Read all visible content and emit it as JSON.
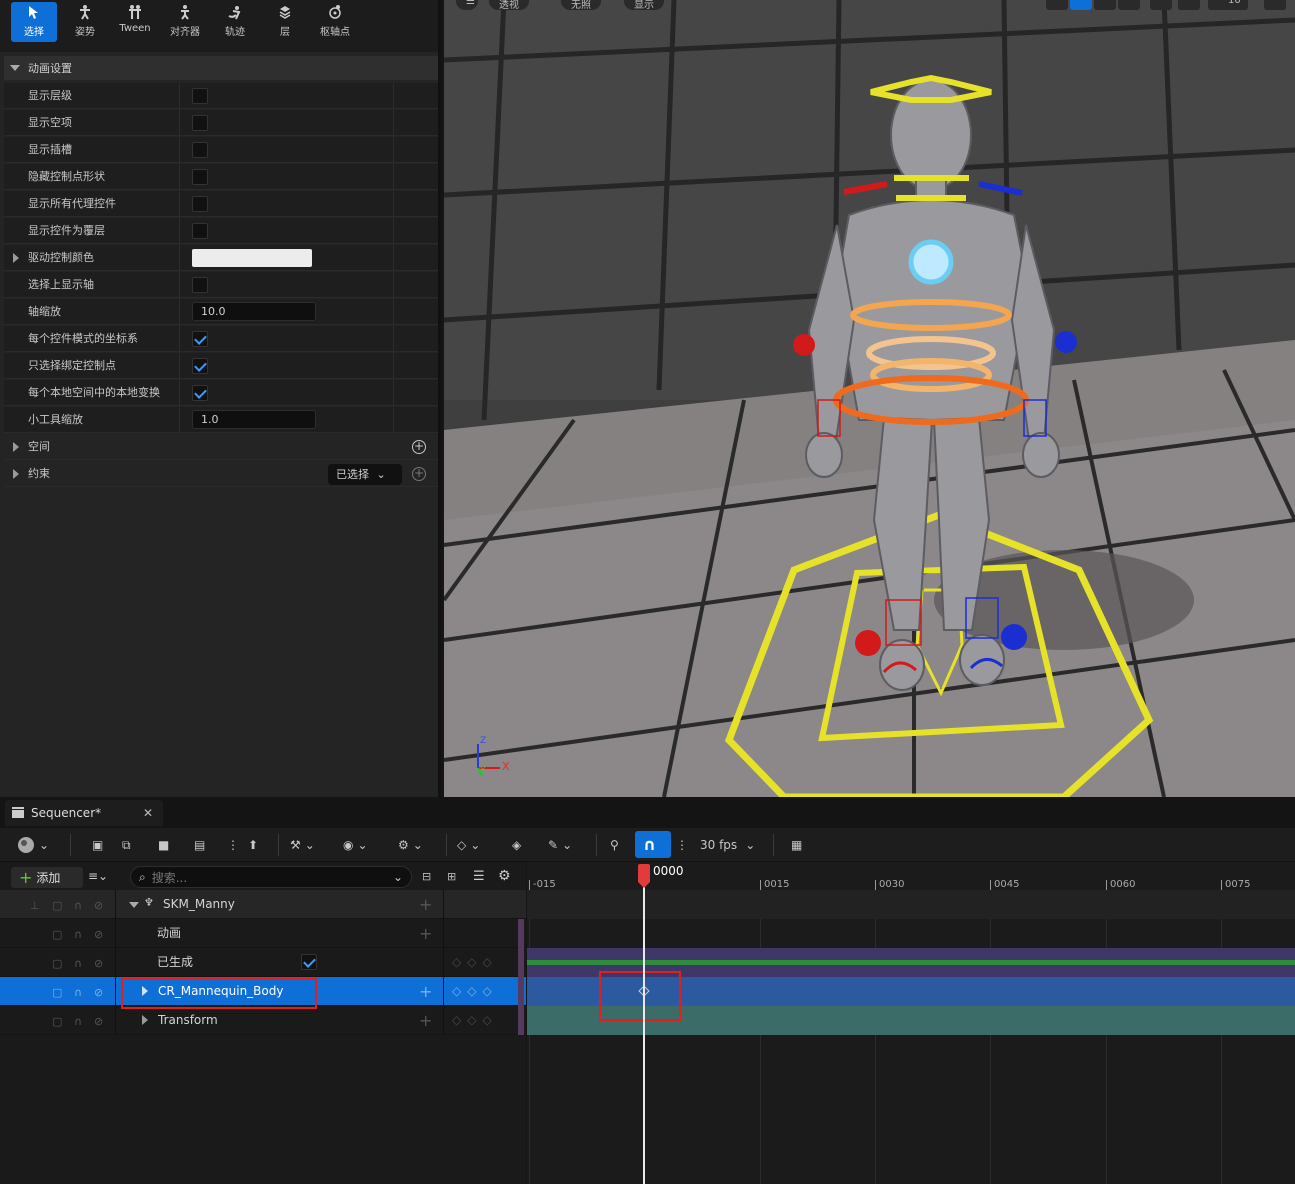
{
  "mode_toolbar": {
    "items": [
      {
        "label": "选择",
        "icon": "select-icon",
        "active": true
      },
      {
        "label": "姿势",
        "icon": "pose-icon",
        "active": false
      },
      {
        "label": "Tween",
        "icon": "tween-icon",
        "active": false
      },
      {
        "label": "对齐器",
        "icon": "aligner-icon",
        "active": false
      },
      {
        "label": "轨迹",
        "icon": "trail-icon",
        "active": false
      },
      {
        "label": "层",
        "icon": "layer-icon",
        "active": false
      },
      {
        "label": "枢轴点",
        "icon": "pivot-icon",
        "active": false
      }
    ]
  },
  "animation_settings": {
    "header": "动画设置",
    "rows": [
      {
        "label": "显示层级",
        "type": "checkbox",
        "checked": false
      },
      {
        "label": "显示空项",
        "type": "checkbox",
        "checked": false
      },
      {
        "label": "显示插槽",
        "type": "checkbox",
        "checked": false
      },
      {
        "label": "隐藏控制点形状",
        "type": "checkbox",
        "checked": false
      },
      {
        "label": "显示所有代理控件",
        "type": "checkbox",
        "checked": false
      },
      {
        "label": "显示控件为覆层",
        "type": "checkbox",
        "checked": false
      },
      {
        "label": "驱动控制颜色",
        "type": "color",
        "color": "#ececec"
      },
      {
        "label": "选择上显示轴",
        "type": "checkbox",
        "checked": false
      },
      {
        "label": "轴缩放",
        "type": "number",
        "value": "10.0"
      },
      {
        "label": "每个控件模式的坐标系",
        "type": "checkbox",
        "checked": true
      },
      {
        "label": "只选择绑定控制点",
        "type": "checkbox",
        "checked": true
      },
      {
        "label": "每个本地空间中的本地变换",
        "type": "checkbox",
        "checked": true
      },
      {
        "label": "小工具缩放",
        "type": "number",
        "value": "1.0"
      }
    ],
    "space_label": "空间",
    "constraint_label": "约束",
    "constraint_dropdown": "已选择"
  },
  "viewport": {
    "pills": [
      "透视",
      "无照",
      "显示"
    ],
    "axis_x": "X",
    "axis_y": "Y",
    "axis_z": "Z",
    "grid_snap": "10"
  },
  "sequencer": {
    "tab_title": "Sequencer*",
    "fps": "30 fps",
    "add_label": "添加",
    "search_placeholder": "搜索...",
    "tracks": [
      {
        "name": "SKM_Manny",
        "level": 0,
        "expanded": true
      },
      {
        "name": "动画",
        "level": 1
      },
      {
        "name": "已生成",
        "level": 1,
        "checked": true
      },
      {
        "name": "CR_Mannequin_Body",
        "level": 1,
        "selected": true
      },
      {
        "name": "Transform",
        "level": 1
      }
    ],
    "current_frame": "0000",
    "ruler": [
      "-015",
      "0015",
      "0030",
      "0045",
      "0060",
      "0075"
    ],
    "colors": {
      "accent": "#0e70d6",
      "playhead": "#e23b3b",
      "highlight_box": "#e02020"
    }
  }
}
